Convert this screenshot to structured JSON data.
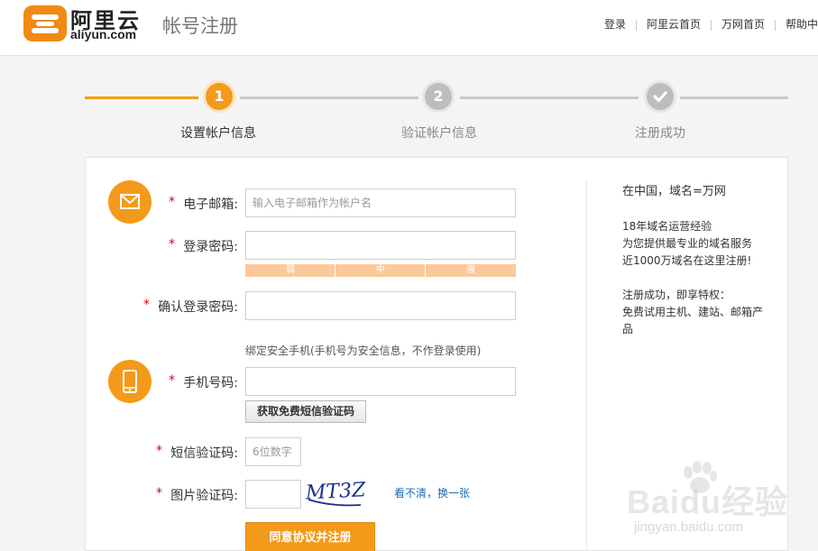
{
  "header": {
    "logo_icon": "aliyun-logo-icon",
    "brand_cn": "阿里云",
    "brand_en": "aliyun.com",
    "page_title": "帐号注册",
    "nav": [
      "登录",
      "阿里云首页",
      "万网首页",
      "帮助中"
    ]
  },
  "steps": [
    {
      "number": "1",
      "label": "设置帐户信息",
      "state": "active"
    },
    {
      "number": "2",
      "label": "验证帐户信息",
      "state": "pending"
    },
    {
      "number": "",
      "label": "注册成功",
      "state": "pending"
    }
  ],
  "form": {
    "required_mark": "*",
    "email_label": "电子邮箱:",
    "email_placeholder": "输入电子邮箱作为帐户名",
    "password_label": "登录密码:",
    "password_value": "",
    "strength": [
      "弱",
      "中",
      "强"
    ],
    "confirm_label": "确认登录密码:",
    "confirm_value": "",
    "phone_hint": "绑定安全手机(手机号为安全信息，不作登录使用)",
    "phone_label": "手机号码:",
    "phone_value": "",
    "sms_button": "获取免费短信验证码",
    "sms_code_label": "短信验证码:",
    "sms_code_placeholder": "6位数字",
    "captcha_label": "图片验证码:",
    "captcha_value": "",
    "captcha_text": "MT3Z",
    "refresh_link": "看不清，换一张",
    "submit_button": "同意协议并注册"
  },
  "sidebar": {
    "slogan": "在中国，域名=万网",
    "para1": [
      "18年域名运营经验",
      "为您提供最专业的域名服务",
      "近1000万域名在这里注册!"
    ],
    "para2": [
      "注册成功，即享特权：",
      "免费试用主机、建站、邮箱产",
      "品"
    ]
  },
  "watermark": {
    "text": "Baidu经验",
    "sub": "jingyan.baidu.com"
  },
  "colors": {
    "accent": "#f39a1b",
    "step_active_line": "#f0a000",
    "step_pending": "#c8c8c8",
    "required": "#d9001b",
    "link": "#1a6cb3"
  }
}
